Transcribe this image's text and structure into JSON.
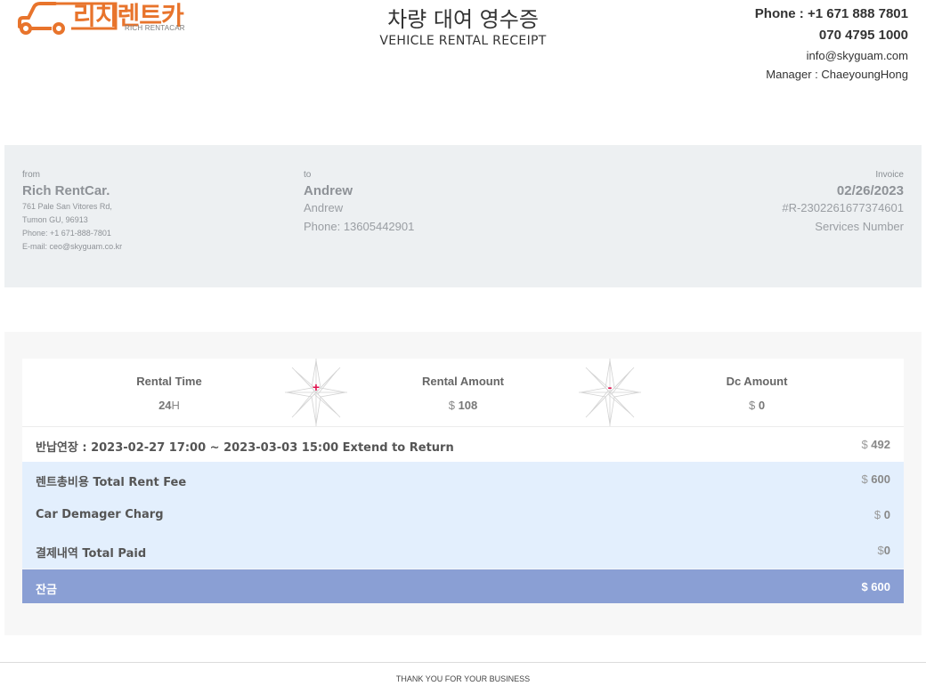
{
  "brand": {
    "name_ko": "리치렌트카",
    "name_en": "RICH RENTACAR",
    "colors": {
      "logo_orange": "#e8742c",
      "logo_dark": "#2b2b2b"
    },
    "icon": "car-outline-icon"
  },
  "header": {
    "title_ko": "차량 대여 영수증",
    "title_en": "VEHICLE RENTAL RECEIPT"
  },
  "contact": {
    "phone1": "Phone : +1 671 888 7801",
    "phone2": "070 4795 1000",
    "email": "info@skyguam.com",
    "manager": "Manager : ChaeyoungHong"
  },
  "from": {
    "label": "from",
    "name": "Rich RentCar.",
    "address1": "761 Pale San Vitores Rd,",
    "address2": "Tumon GU, 96913",
    "phone": "Phone: +1 671-888-7801",
    "email": "E-mail: ceo@skyguam.co.kr"
  },
  "to": {
    "label": "to",
    "name": "Andrew",
    "name2": "Andrew",
    "phone": "Phone: 13605442901"
  },
  "invoice": {
    "label": "Invoice",
    "date": "02/26/2023",
    "number": "#R-2302261677374601",
    "services": "Services Number"
  },
  "summary": {
    "rental_time": {
      "label": "Rental Time",
      "value": "24",
      "unit": "H"
    },
    "plus": "+",
    "rental_amount": {
      "label": "Rental Amount",
      "currency": "$",
      "value": "108"
    },
    "minus": "-",
    "dc_amount": {
      "label": "Dc Amount",
      "currency": "$",
      "value": "0"
    }
  },
  "rows": {
    "extend": {
      "label": "반납연장 : 2023-02-27 17:00 ~ 2023-03-03 15:00 Extend to Return",
      "currency": "$",
      "value": "492"
    },
    "total": {
      "label": "렌트총비용 Total Rent Fee",
      "currency": "$",
      "value": "600"
    },
    "damage": {
      "label": "Car Demager Charg",
      "currency": "$",
      "value": "0"
    },
    "paid": {
      "label": "결제내역 Total Paid",
      "currency": "$",
      "value": "0"
    },
    "balance": {
      "label": "잔금",
      "currency": "$",
      "value": "600"
    }
  },
  "colors": {
    "info_bg": "#edf0f2",
    "row_blue": "#e3effd",
    "balance_bg": "#8a9fd4",
    "operator_red": "#e0104d"
  },
  "footer": {
    "text": "THANK YOU FOR YOUR BUSINESS"
  }
}
